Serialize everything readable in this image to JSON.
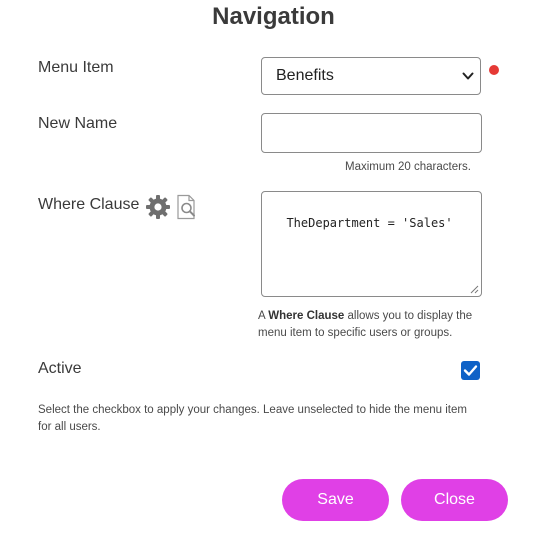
{
  "dialog": {
    "title": "Navigation"
  },
  "form": {
    "menu_item": {
      "label": "Menu Item",
      "selected": "Benefits"
    },
    "new_name": {
      "label": "New Name",
      "value": "",
      "hint": "Maximum 20 characters."
    },
    "where_clause": {
      "label": "Where Clause",
      "value": "TheDepartment = 'Sales'",
      "hint_prefix": "A ",
      "hint_bold": "Where Clause",
      "hint_rest_line1": " allows you to display the",
      "hint_line2": "menu item to specific users or groups."
    },
    "active": {
      "label": "Active",
      "checked": true,
      "hint_line1": "Select the checkbox to apply your changes. Leave unselected to hide the menu item",
      "hint_line2": "for all users."
    }
  },
  "buttons": {
    "save": "Save",
    "close": "Close"
  },
  "icons": {
    "gear": "gear-icon",
    "preview": "magnifier-document-icon",
    "required": "required-dot",
    "select_chevron": "chevron-down-icon",
    "checkbox": "checkmark-icon"
  },
  "colors": {
    "accent_button": "#e040e6",
    "required_dot": "#e53935",
    "checkbox": "#0f62c7"
  }
}
